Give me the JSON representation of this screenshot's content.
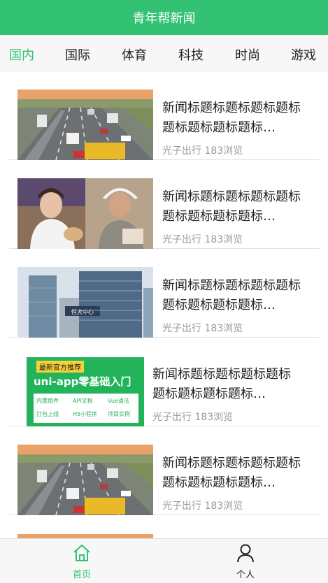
{
  "header": {
    "title": "青年帮新闻"
  },
  "tabs": [
    {
      "label": "国内",
      "active": true
    },
    {
      "label": "国际",
      "active": false
    },
    {
      "label": "体育",
      "active": false
    },
    {
      "label": "科技",
      "active": false
    },
    {
      "label": "时尚",
      "active": false
    },
    {
      "label": "游戏",
      "active": false
    }
  ],
  "news": [
    {
      "title": "新闻标题标题标题标题标题标题标题标题标…",
      "meta": "光子出行 183浏览",
      "image": "highway-traffic"
    },
    {
      "title": "新闻标题标题标题标题标题标题标题标题标…",
      "meta": "光子出行 183浏览",
      "image": "two-men-portrait"
    },
    {
      "title": "新闻标题标题标题标题标题标题标题标题标…",
      "meta": "光子出行 183浏览",
      "image": "office-buildings"
    },
    {
      "title": "新闻标题标题标题标题标题标题标题标题标…",
      "meta": "光子出行 183浏览",
      "image": "uni-app-promo",
      "promo": {
        "badge": "最新官方推荐",
        "headline": "uni-app零基础入门",
        "tags": [
          "内置组件",
          "API文档",
          "Vue语法",
          "打包上线",
          "H5小程序",
          "项目实例"
        ]
      }
    },
    {
      "title": "新闻标题标题标题标题标题标题标题标题标…",
      "meta": "光子出行 183浏览",
      "image": "highway-traffic"
    }
  ],
  "tabbar": [
    {
      "label": "首页",
      "icon": "home-icon",
      "active": true
    },
    {
      "label": "个人",
      "icon": "person-icon",
      "active": false
    }
  ],
  "colors": {
    "accent": "#33c174",
    "text": "#222222",
    "muted": "#999999"
  }
}
